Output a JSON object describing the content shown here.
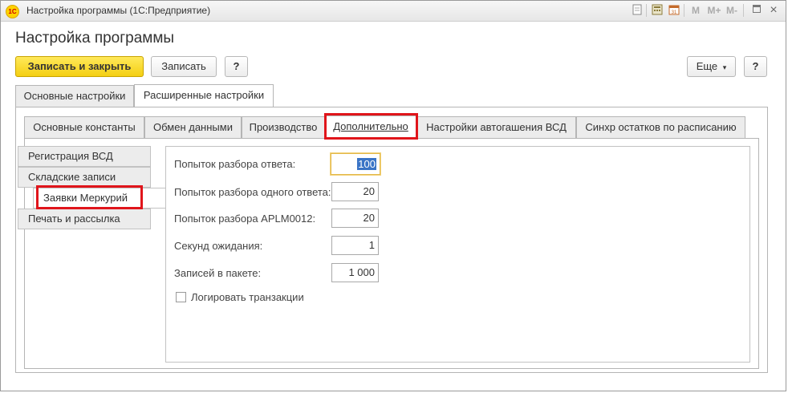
{
  "window": {
    "title": "Настройка программы  (1С:Предприятие)",
    "logo_text": "1С"
  },
  "titlebar_icons": [
    "doc-icon",
    "calculator-icon",
    "calendar-icon",
    "memory-m-icon",
    "memory-mplus-icon",
    "memory-mminus-icon",
    "restore-icon",
    "close-icon"
  ],
  "titlebar_icon_glyphs": {
    "m": "M",
    "mplus": "M+",
    "mminus": "M-",
    "close": "×"
  },
  "page_title": "Настройка программы",
  "toolbar": {
    "save_close_label": "Записать и закрыть",
    "save_label": "Записать",
    "help_label": "?",
    "more_label": "Еще",
    "more_arrow": "▾",
    "help2_label": "?"
  },
  "top_tabs": [
    "Основные настройки",
    "Расширенные настройки"
  ],
  "inner_tabs": [
    "Основные константы",
    "Обмен данными",
    "Производство",
    "Дополнительно",
    "Настройки автогашения ВСД",
    "Синхр остатков по расписанию"
  ],
  "side_items": [
    "Регистрация ВСД",
    "Складские записи",
    "Заявки Меркурий",
    "Печать и рассылка"
  ],
  "fields": [
    {
      "label": "Попыток разбора ответа:",
      "value": "100"
    },
    {
      "label": "Попыток разбора одного ответа:",
      "value": "20"
    },
    {
      "label": "Попыток разбора APLM0012:",
      "value": "20"
    },
    {
      "label": "Секунд ожидания:",
      "value": "1"
    },
    {
      "label": "Записей в пакете:",
      "value": "1 000"
    }
  ],
  "checkbox": {
    "label": "Логировать транзакции",
    "checked": false
  },
  "colors": {
    "accent_yellow": "#f4cf13",
    "highlight_red": "#e0151b",
    "focus_border": "#e3b84a",
    "selection_blue": "#3a74c6"
  }
}
